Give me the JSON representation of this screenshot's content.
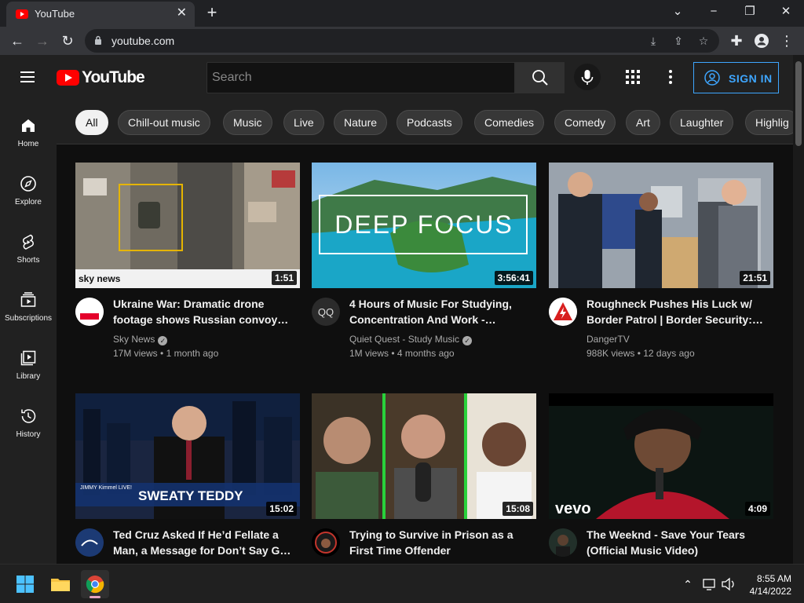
{
  "browser": {
    "tab_title": "YouTube",
    "url": "youtube.com"
  },
  "header": {
    "logo_text": "YouTube",
    "search_placeholder": "Search",
    "signin_label": "SIGN IN"
  },
  "sidebar": {
    "items": [
      {
        "label": "Home",
        "icon": "home-icon"
      },
      {
        "label": "Explore",
        "icon": "compass-icon"
      },
      {
        "label": "Shorts",
        "icon": "shorts-icon"
      },
      {
        "label": "Subscriptions",
        "icon": "subscriptions-icon"
      },
      {
        "label": "Library",
        "icon": "library-icon"
      },
      {
        "label": "History",
        "icon": "history-icon"
      }
    ]
  },
  "chips": [
    "All",
    "Chill-out music",
    "Music",
    "Live",
    "Nature",
    "Podcasts",
    "Comedies",
    "Comedy",
    "Art",
    "Laughter",
    "Highlig"
  ],
  "videos": [
    {
      "title": "Ukraine War: Dramatic drone footage shows Russian convoy…",
      "channel": "Sky News",
      "verified": true,
      "views": "17M views",
      "age": "1 month ago",
      "duration": "1:51",
      "thumb_text": "sky news"
    },
    {
      "title": "4 Hours of Music For Studying, Concentration And Work -…",
      "channel": "Quiet Quest - Study Music",
      "verified": true,
      "views": "1M views",
      "age": "4 months ago",
      "duration": "3:56:41",
      "thumb_text": "DEEP FOCUS",
      "avatar_text": "QQ"
    },
    {
      "title": "Roughneck Pushes His Luck w/ Border Patrol | Border Security:…",
      "channel": "DangerTV",
      "verified": false,
      "views": "988K views",
      "age": "12 days ago",
      "duration": "21:51"
    },
    {
      "title": "Ted Cruz Asked If He’d Fellate a Man, a Message for Don’t Say G…",
      "duration": "15:02",
      "thumb_text": "SWEATY TEDDY",
      "thumb_logo": "JIMMY Kimmel LIVE!"
    },
    {
      "title": "Trying to Survive in Prison as a First Time Offender",
      "duration": "15:08"
    },
    {
      "title": "The Weeknd - Save Your Tears (Official Music Video)",
      "duration": "4:09",
      "thumb_text": "vevo"
    }
  ],
  "taskbar": {
    "time": "8:55 AM",
    "date": "4/14/2022"
  }
}
